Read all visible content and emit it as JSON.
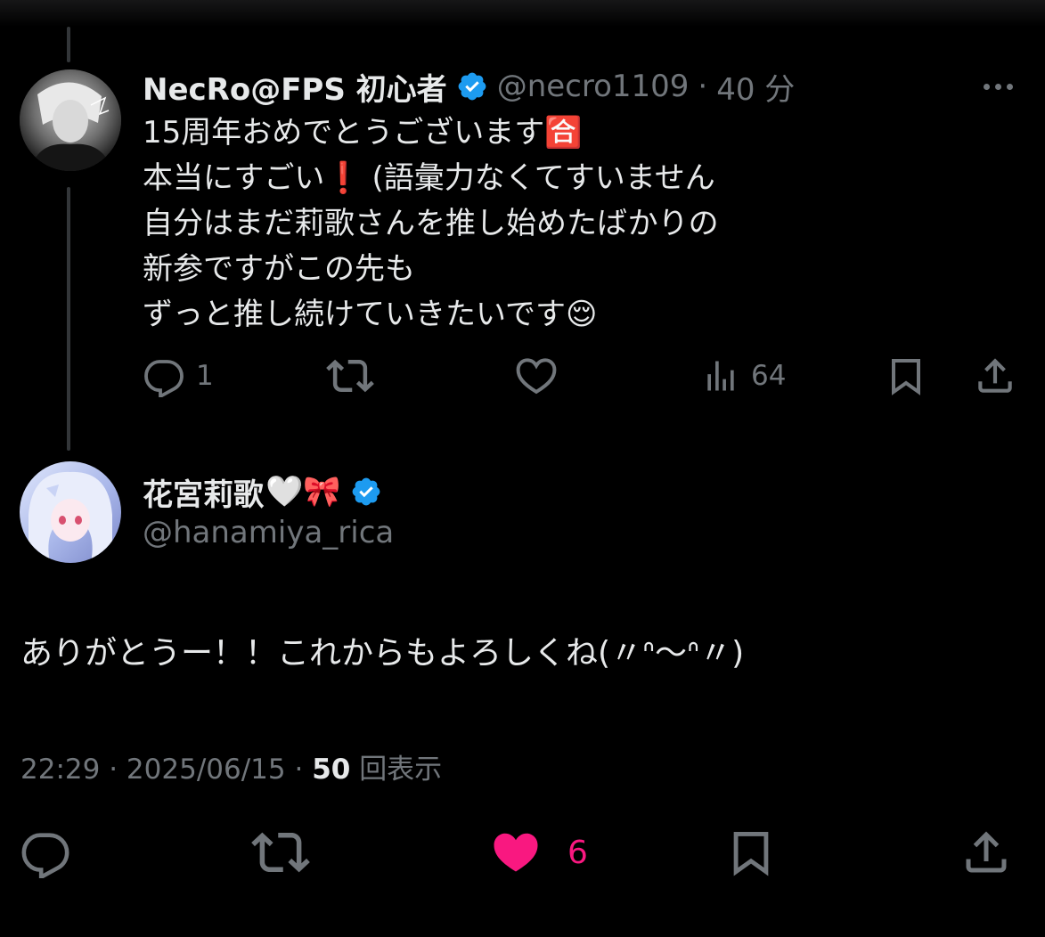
{
  "reply": {
    "display_name": "NecRo@FPS 初心者",
    "handle": "@necro1109",
    "separator": "·",
    "time": "40 分",
    "lines": [
      "15周年おめでとうございます🈴",
      "本当にすごい❗️ (語彙力なくてすいません",
      "自分はまだ莉歌さんを推し始めたばかりの",
      "新参ですがこの先も",
      "ずっと推し続けていきたいです😌"
    ],
    "reply_count": "1",
    "views_count": "64"
  },
  "main": {
    "display_name": "花宮莉歌",
    "name_emojis": "🤍🎀",
    "handle": "@hanamiya_rica",
    "text": "ありがとうー！！これからもよろしくね(〃ᐢ〜ᐢ〃)",
    "time": "22:29",
    "date": "2025/06/15",
    "views_number": "50",
    "views_label": "回表示",
    "like_count": "6"
  },
  "colors": {
    "background": "#000000",
    "text_primary": "#e7e9ea",
    "text_secondary": "#71767b",
    "verified": "#1d9bf0",
    "like": "#f91880",
    "thread_line": "#333639"
  },
  "icons": {
    "reply": "reply-icon",
    "retweet": "retweet-icon",
    "like": "heart-icon",
    "views": "views-icon",
    "bookmark": "bookmark-icon",
    "share": "share-icon",
    "more": "more-icon",
    "verified": "verified-icon"
  }
}
